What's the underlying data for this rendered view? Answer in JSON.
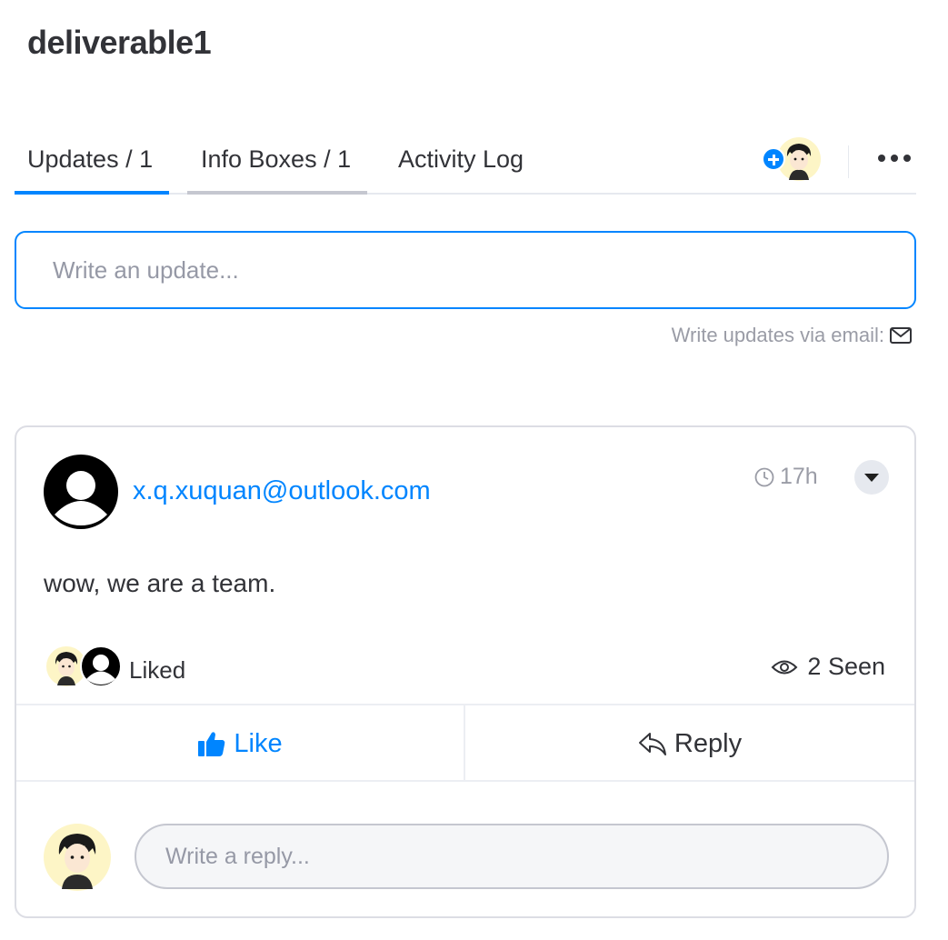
{
  "board_item": {
    "title": "deliverable1"
  },
  "tabs": [
    {
      "label": "Updates / 1",
      "active": true
    },
    {
      "label": "Info Boxes / 1",
      "active": false
    },
    {
      "label": "Activity Log",
      "active": false
    }
  ],
  "header_icons": {
    "add_subscriber": "plus-icon",
    "more": "ellipsis-icon"
  },
  "composer": {
    "placeholder": "Write an update...",
    "email_hint": "Write updates via email:",
    "email_icon": "envelope-icon"
  },
  "update": {
    "author": "x.q.xuquan@outlook.com",
    "time": "17h",
    "body": "wow, we are a team.",
    "liked_label": "Liked",
    "seen_label": "2 Seen",
    "like_label": "Like",
    "reply_label": "Reply",
    "reply_placeholder": "Write a reply..."
  },
  "colors": {
    "accent": "#0085ff",
    "text": "#323338",
    "muted": "#9a9ca6",
    "border": "#dcdde4",
    "avatar_bg": "#fdf5c6"
  }
}
